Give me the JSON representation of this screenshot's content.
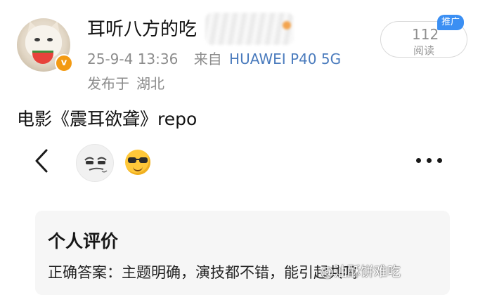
{
  "post_header": {
    "username": "耳听八方的吃",
    "timestamp": "25-9-4 13:36",
    "source_prefix": "来自",
    "device": "HUAWEI P40 5G",
    "location_prefix": "发布于",
    "location": "湖北",
    "verified_badge": "v"
  },
  "promo": {
    "tag": "推广",
    "count": "112",
    "count_label": "阅读"
  },
  "post": {
    "text": "电影《震耳欲聋》repo"
  },
  "embedded_screen": {
    "back_icon": "chevron-left-icon",
    "more_icon": "ellipsis-icon",
    "emoji": "sunglasses-emoji-icon",
    "card_title": "个人评价",
    "card_body": "正确答案：主题明确，演技都不错，能引起共鸣"
  },
  "watermark": {
    "text": "@油酥饼难吃"
  },
  "colors": {
    "device_link": "#4a7bbd",
    "promo_tag": "#3b8ff3",
    "verified_badge": "#f39a12"
  }
}
